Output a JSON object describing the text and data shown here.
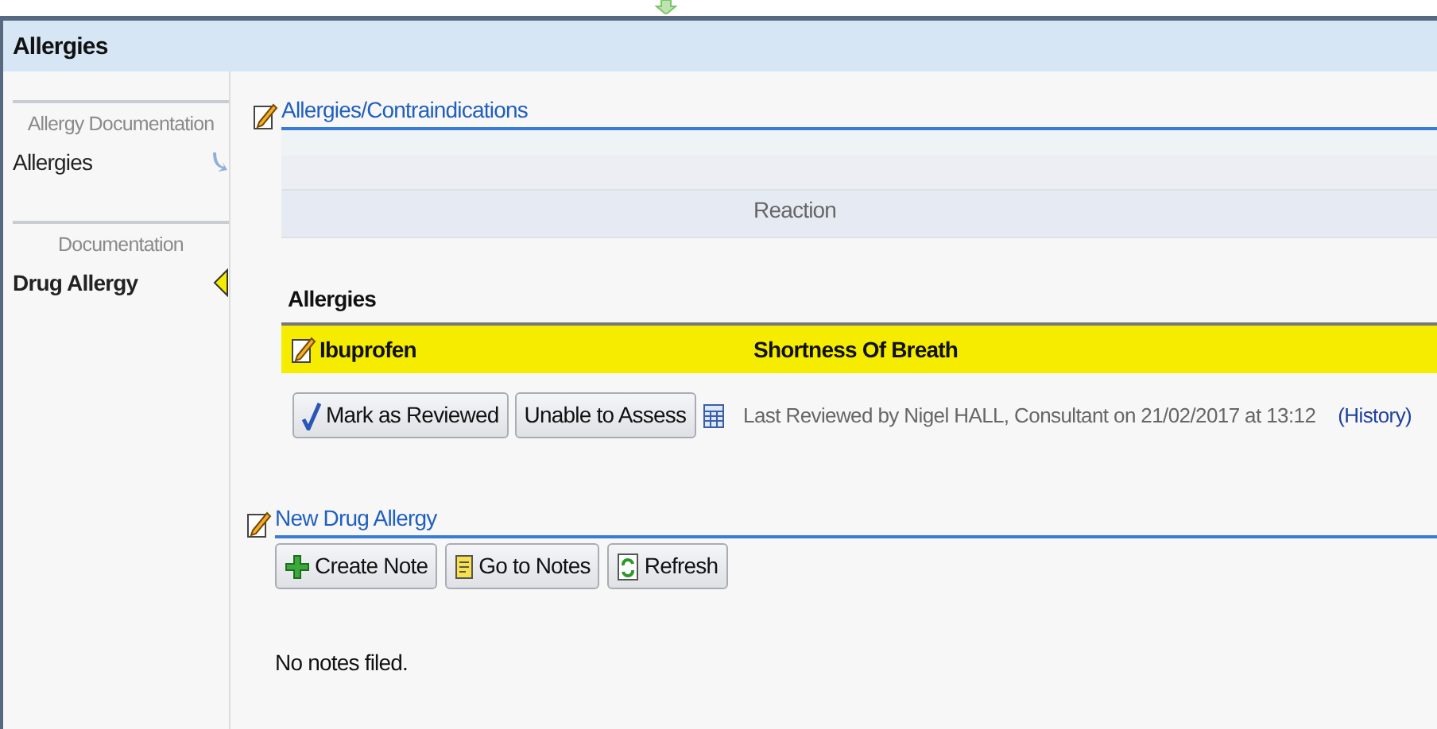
{
  "window": {
    "title": "Allergies"
  },
  "sidebar": {
    "sections": [
      {
        "heading": "Allergy Documentation",
        "items": [
          {
            "label": "Allergies",
            "selected": false
          }
        ]
      },
      {
        "heading": "Documentation",
        "items": [
          {
            "label": "Drug Allergy",
            "selected": true
          }
        ]
      }
    ]
  },
  "allergies_section": {
    "title": "Allergies/Contraindications",
    "table": {
      "columns": [
        "Reaction"
      ],
      "group": "Allergies",
      "rows": [
        {
          "allergen": "Ibuprofen",
          "reaction": "Shortness Of Breath",
          "highlighted": true
        }
      ]
    },
    "buttons": [
      {
        "label": "Mark as Reviewed",
        "kind": "check"
      },
      {
        "label": "Unable to Assess",
        "kind": "plain"
      }
    ],
    "review_text": "Last Reviewed by Nigel HALL, Consultant on 21/02/2017 at 13:12",
    "history_link": "(History)"
  },
  "notes_section": {
    "title": "New Drug Allergy",
    "buttons": [
      {
        "label": "Create Note",
        "kind": "plus"
      },
      {
        "label": "Go to Notes",
        "kind": "note"
      },
      {
        "label": "Refresh",
        "kind": "refresh"
      }
    ],
    "message": "No notes filed."
  }
}
